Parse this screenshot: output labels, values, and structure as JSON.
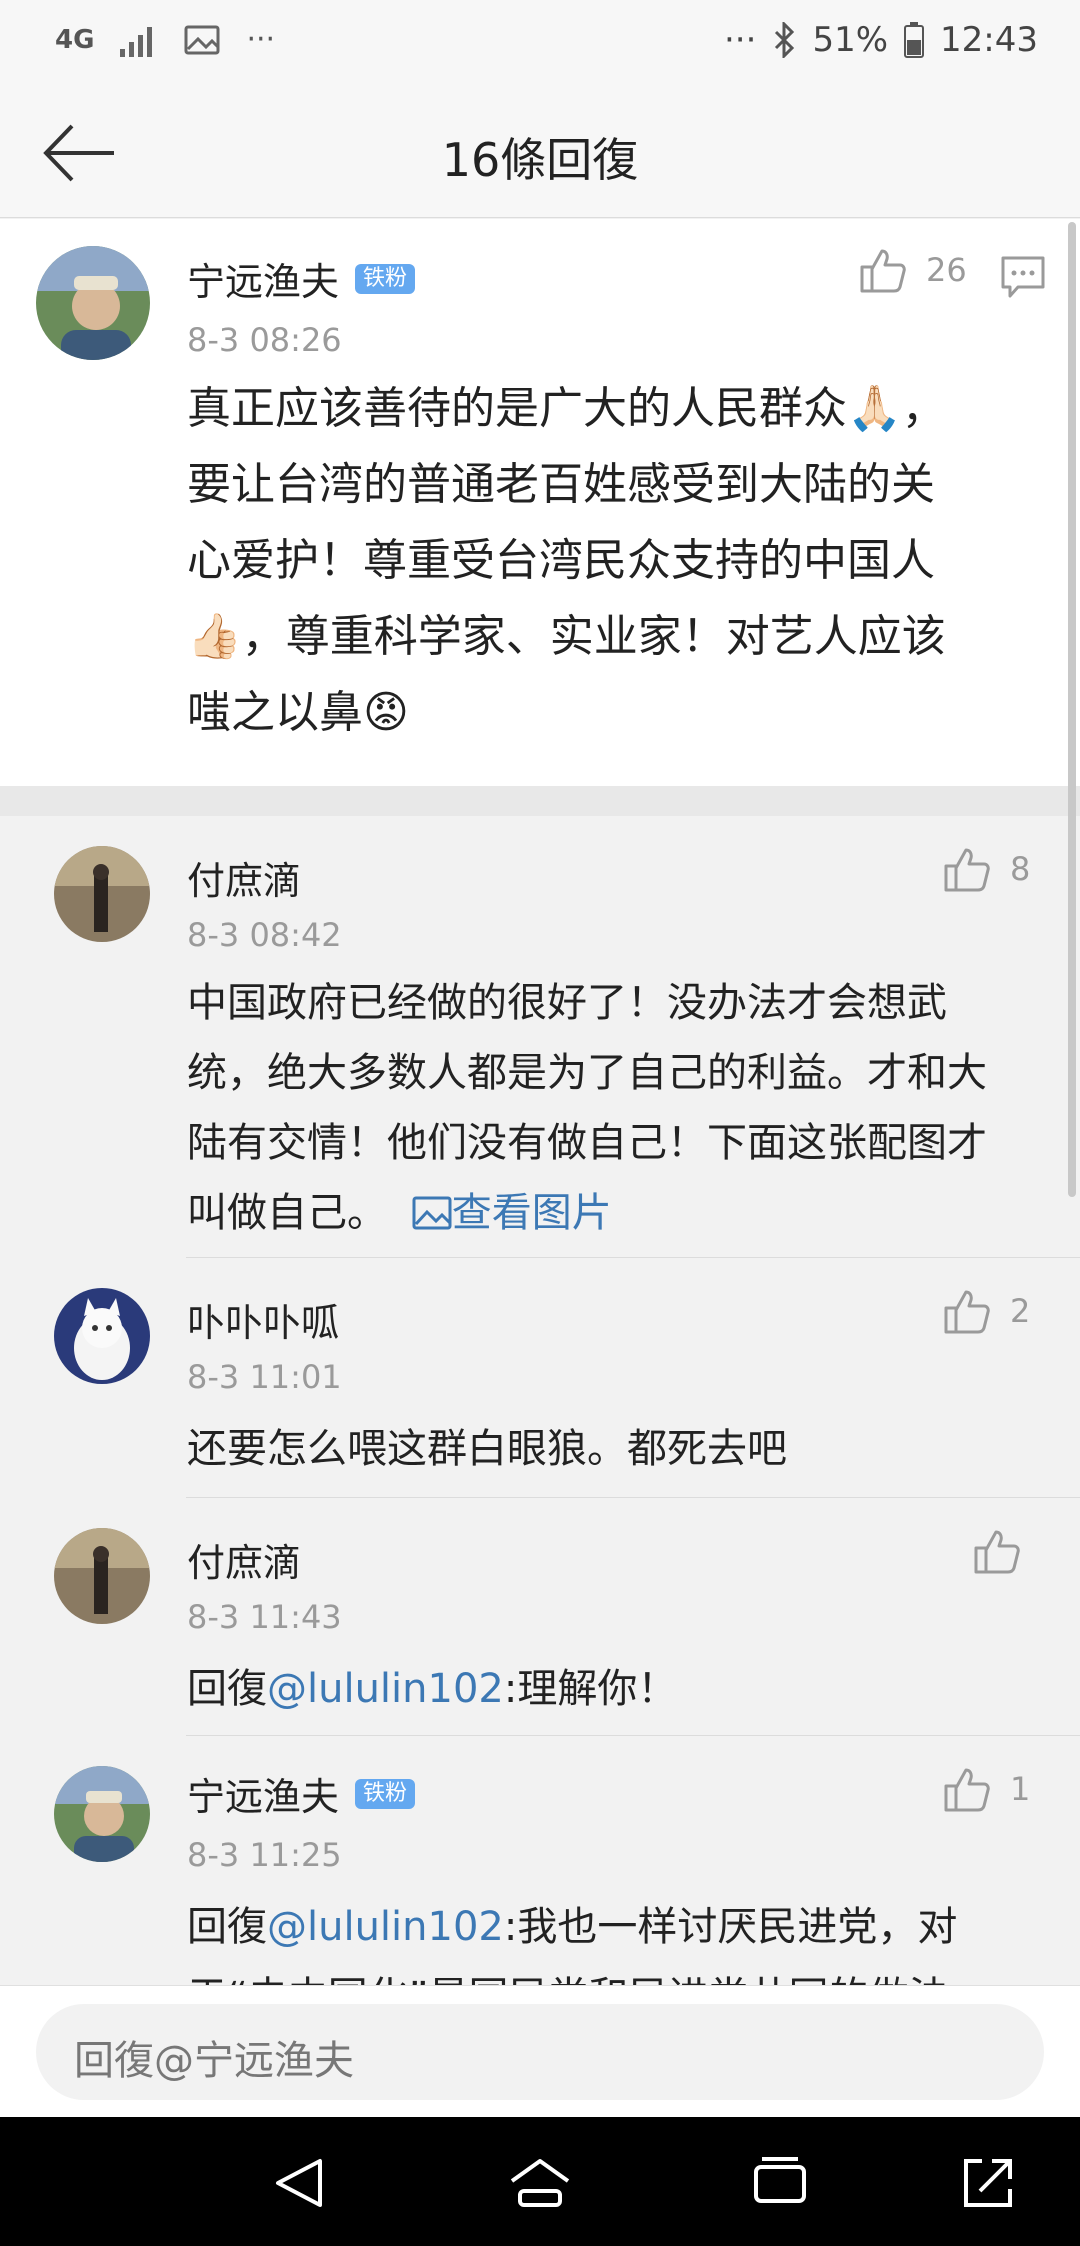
{
  "status_bar": {
    "network": "4G",
    "battery": "51%",
    "time": "12:43",
    "dots_left": "···",
    "dots_right": "···"
  },
  "header": {
    "title": "16條回復"
  },
  "main_comment": {
    "user": "宁远渔夫",
    "badge": "铁粉",
    "time": "8-3 08:26",
    "likes": "26",
    "text_lines": [
      "真正应该善待的是广大的人民群众🙏🏻，",
      "要让台湾的普通老百姓感受到大陆的关",
      "心爱护！尊重受台湾民众支持的中国人",
      "👍🏻，尊重科学家、实业家！对艺人应该",
      "嗤之以鼻😡"
    ]
  },
  "replies": [
    {
      "user": "付庶滴",
      "time": "8-3 08:42",
      "likes": "8",
      "lines": [
        "中国政府已经做的很好了！没办法才会想武",
        "统，绝大多数人都是为了自己的利益。才和大",
        "陆有交情！他们没有做自己！下面这张配图才"
      ],
      "last_line": "叫做自己。",
      "view_image": "查看图片"
    },
    {
      "user": "卟卟卟呱",
      "time": "8-3 11:01",
      "likes": "2",
      "text": "还要怎么喂这群白眼狼。都死去吧"
    },
    {
      "user": "付庶滴",
      "time": "8-3 11:43",
      "likes": "",
      "prefix": "回復",
      "mention": "@lululin102",
      "text": ":理解你！"
    },
    {
      "user": "宁远渔夫",
      "badge": "铁粉",
      "time": "8-3 11:25",
      "likes": "1",
      "prefix": "回復",
      "mention": "@lululin102",
      "text": ":我也一样讨厌民进党，对",
      "cut_line": "于“去中国化”是国民党和民进党共同的做法"
    }
  ],
  "reply_input": {
    "placeholder": "回復@宁远渔夫"
  }
}
